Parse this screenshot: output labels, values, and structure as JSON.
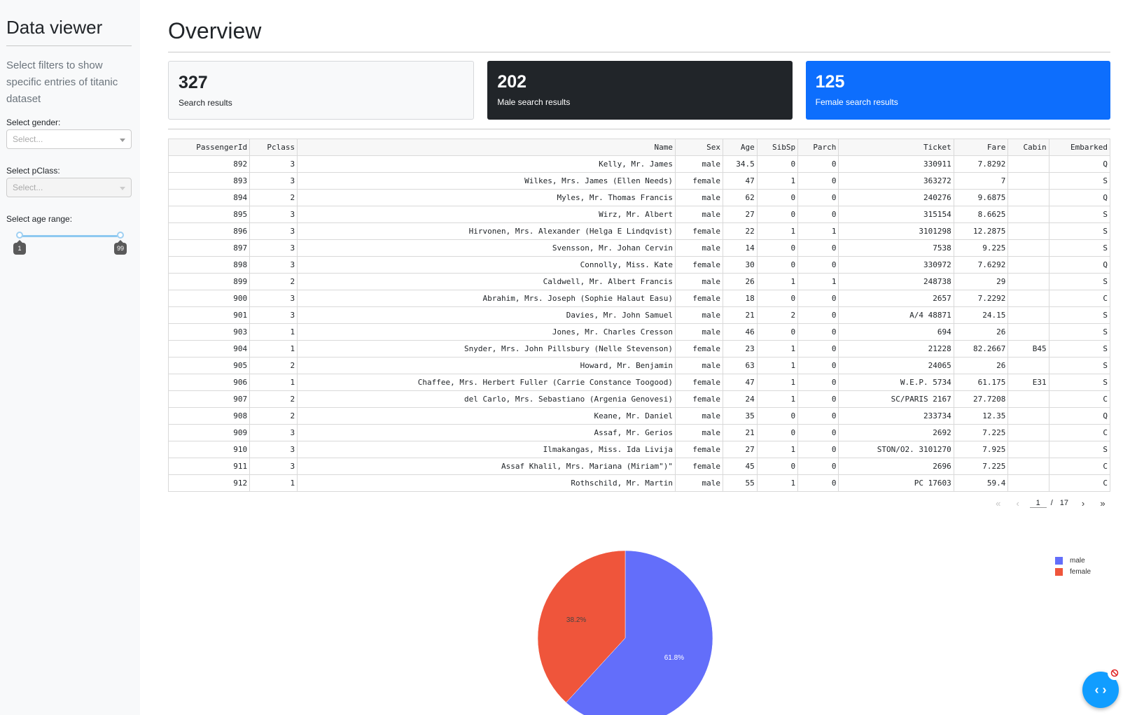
{
  "sidebar": {
    "title": "Data viewer",
    "description": "Select filters to show specific entries of titanic dataset",
    "gender_label": "Select gender:",
    "gender_placeholder": "Select...",
    "pclass_label": "Select pClass:",
    "pclass_placeholder": "Select...",
    "age_label": "Select age range:",
    "age_min": "1",
    "age_max": "99"
  },
  "main": {
    "title": "Overview",
    "cards": [
      {
        "number": "327",
        "caption": "Search results"
      },
      {
        "number": "202",
        "caption": "Male search results"
      },
      {
        "number": "125",
        "caption": "Female search results"
      }
    ]
  },
  "table": {
    "columns": [
      "PassengerId",
      "Pclass",
      "Name",
      "Sex",
      "Age",
      "SibSp",
      "Parch",
      "Ticket",
      "Fare",
      "Cabin",
      "Embarked"
    ],
    "rows": [
      [
        "892",
        "3",
        "Kelly, Mr. James",
        "male",
        "34.5",
        "0",
        "0",
        "330911",
        "7.8292",
        "",
        "Q"
      ],
      [
        "893",
        "3",
        "Wilkes, Mrs. James (Ellen Needs)",
        "female",
        "47",
        "1",
        "0",
        "363272",
        "7",
        "",
        "S"
      ],
      [
        "894",
        "2",
        "Myles, Mr. Thomas Francis",
        "male",
        "62",
        "0",
        "0",
        "240276",
        "9.6875",
        "",
        "Q"
      ],
      [
        "895",
        "3",
        "Wirz, Mr. Albert",
        "male",
        "27",
        "0",
        "0",
        "315154",
        "8.6625",
        "",
        "S"
      ],
      [
        "896",
        "3",
        "Hirvonen, Mrs. Alexander (Helga E Lindqvist)",
        "female",
        "22",
        "1",
        "1",
        "3101298",
        "12.2875",
        "",
        "S"
      ],
      [
        "897",
        "3",
        "Svensson, Mr. Johan Cervin",
        "male",
        "14",
        "0",
        "0",
        "7538",
        "9.225",
        "",
        "S"
      ],
      [
        "898",
        "3",
        "Connolly, Miss. Kate",
        "female",
        "30",
        "0",
        "0",
        "330972",
        "7.6292",
        "",
        "Q"
      ],
      [
        "899",
        "2",
        "Caldwell, Mr. Albert Francis",
        "male",
        "26",
        "1",
        "1",
        "248738",
        "29",
        "",
        "S"
      ],
      [
        "900",
        "3",
        "Abrahim, Mrs. Joseph (Sophie Halaut Easu)",
        "female",
        "18",
        "0",
        "0",
        "2657",
        "7.2292",
        "",
        "C"
      ],
      [
        "901",
        "3",
        "Davies, Mr. John Samuel",
        "male",
        "21",
        "2",
        "0",
        "A/4 48871",
        "24.15",
        "",
        "S"
      ],
      [
        "903",
        "1",
        "Jones, Mr. Charles Cresson",
        "male",
        "46",
        "0",
        "0",
        "694",
        "26",
        "",
        "S"
      ],
      [
        "904",
        "1",
        "Snyder, Mrs. John Pillsbury (Nelle Stevenson)",
        "female",
        "23",
        "1",
        "0",
        "21228",
        "82.2667",
        "B45",
        "S"
      ],
      [
        "905",
        "2",
        "Howard, Mr. Benjamin",
        "male",
        "63",
        "1",
        "0",
        "24065",
        "26",
        "",
        "S"
      ],
      [
        "906",
        "1",
        "Chaffee, Mrs. Herbert Fuller (Carrie Constance Toogood)",
        "female",
        "47",
        "1",
        "0",
        "W.E.P. 5734",
        "61.175",
        "E31",
        "S"
      ],
      [
        "907",
        "2",
        "del Carlo, Mrs. Sebastiano (Argenia Genovesi)",
        "female",
        "24",
        "1",
        "0",
        "SC/PARIS 2167",
        "27.7208",
        "",
        "C"
      ],
      [
        "908",
        "2",
        "Keane, Mr. Daniel",
        "male",
        "35",
        "0",
        "0",
        "233734",
        "12.35",
        "",
        "Q"
      ],
      [
        "909",
        "3",
        "Assaf, Mr. Gerios",
        "male",
        "21",
        "0",
        "0",
        "2692",
        "7.225",
        "",
        "C"
      ],
      [
        "910",
        "3",
        "Ilmakangas, Miss. Ida Livija",
        "female",
        "27",
        "1",
        "0",
        "STON/O2. 3101270",
        "7.925",
        "",
        "S"
      ],
      [
        "911",
        "3",
        "Assaf Khalil, Mrs. Mariana (Miriam\")\"",
        "female",
        "45",
        "0",
        "0",
        "2696",
        "7.225",
        "",
        "C"
      ],
      [
        "912",
        "1",
        "Rothschild, Mr. Martin",
        "male",
        "55",
        "1",
        "0",
        "PC 17603",
        "59.4",
        "",
        "C"
      ]
    ]
  },
  "pager": {
    "current": "1",
    "separator": "/",
    "total": "17"
  },
  "chart_data": {
    "type": "pie",
    "labels": [
      "male",
      "female"
    ],
    "values": [
      61.8,
      38.2
    ],
    "value_labels": [
      "61.8%",
      "38.2%"
    ],
    "colors": [
      "#636efa",
      "#ef553b"
    ],
    "legend": "top-right"
  },
  "colors": {
    "accent_blue": "#0d6efd",
    "dark": "#212529",
    "fab": "#119dff"
  },
  "icons": {
    "fab": "code-icon",
    "fab_badge": "no-entry-icon"
  }
}
